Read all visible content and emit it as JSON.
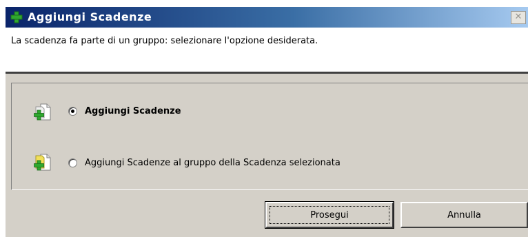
{
  "window": {
    "title": "Aggiungi Scadenze",
    "close_glyph": "✕",
    "title_icon": "green-plus-icon"
  },
  "header": {
    "message": "La scadenza fa parte di un gruppo: selezionare l'opzione desiderata."
  },
  "options": [
    {
      "label": "Aggiungi Scadenze",
      "selected": true,
      "icon": "add-document-icon"
    },
    {
      "label": "Aggiungi Scadenze al gruppo della Scadenza selezionata",
      "selected": false,
      "icon": "add-to-group-document-icon"
    }
  ],
  "buttons": {
    "proceed": "Prosegui",
    "cancel": "Annulla"
  },
  "colors": {
    "titlebar_start": "#0a246a",
    "titlebar_end": "#a6caf0",
    "dialog_bg": "#d4d0c8",
    "plus_green": "#2fa82f",
    "folder_yellow": "#f2e05a"
  }
}
